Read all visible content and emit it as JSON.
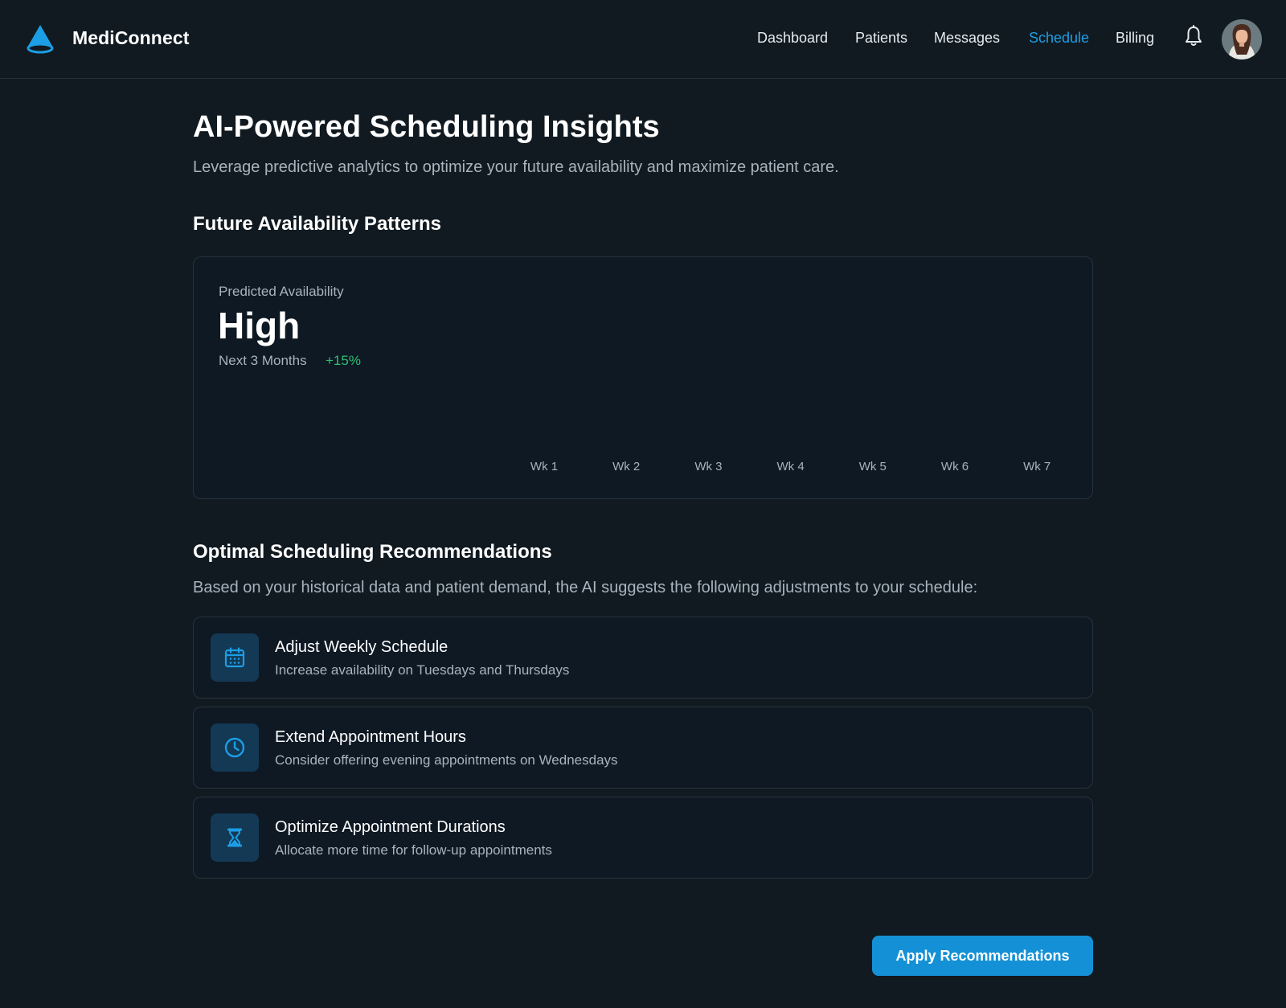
{
  "app": {
    "brand_name": "MediConnect",
    "logo_icon": "cone-logo-icon",
    "accent_color": "#1c9ee6"
  },
  "nav": {
    "items": [
      {
        "label": "Dashboard",
        "active": false
      },
      {
        "label": "Patients",
        "active": false
      },
      {
        "label": "Messages",
        "active": false
      },
      {
        "label": "Schedule",
        "active": true
      },
      {
        "label": "Billing",
        "active": false
      }
    ],
    "notification_icon": "bell-icon",
    "avatar_icon": "user-avatar"
  },
  "page": {
    "title": "AI-Powered Scheduling Insights",
    "subtitle": "Leverage predictive analytics to optimize your future availability and maximize patient care."
  },
  "availability": {
    "section_title": "Future Availability Patterns",
    "metric_label": "Predicted Availability",
    "metric_value": "High",
    "period": "Next 3 Months",
    "change": "+15%",
    "change_color": "#2fbf71"
  },
  "chart_data": {
    "type": "bar",
    "categories": [
      "Wk 1",
      "Wk 2",
      "Wk 3",
      "Wk 4",
      "Wk 5",
      "Wk 6",
      "Wk 7"
    ],
    "values": []
  },
  "recommendations": {
    "section_title": "Optimal Scheduling Recommendations",
    "intro": "Based on your historical data and patient demand, the AI suggests the following adjustments to your schedule:",
    "items": [
      {
        "title": "Adjust Weekly Schedule",
        "description": "Increase availability on Tuesdays and Thursdays",
        "icon": "calendar-icon"
      },
      {
        "title": "Extend Appointment Hours",
        "description": "Consider offering evening appointments on Wednesdays",
        "icon": "clock-icon"
      },
      {
        "title": "Optimize Appointment Durations",
        "description": "Allocate more time for follow-up appointments",
        "icon": "hourglass-icon"
      }
    ]
  },
  "actions": {
    "apply_label": "Apply Recommendations"
  }
}
